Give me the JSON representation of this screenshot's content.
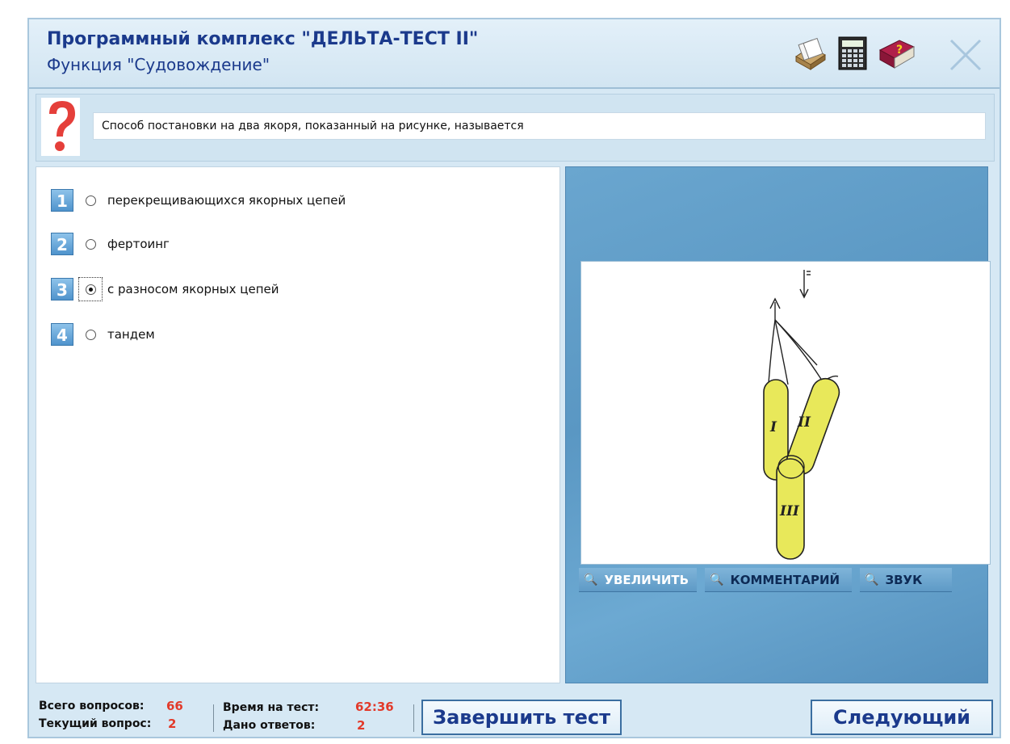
{
  "header": {
    "title": "Программный комплекс \"ДЕЛЬТА-ТЕСТ II\"",
    "subtitle": "Функция \"Судовождение\"",
    "icons": [
      "card-index-icon",
      "calculator-icon",
      "help-book-icon",
      "close-icon"
    ]
  },
  "question": {
    "icon": "question-mark-icon",
    "text": "Способ постановки на два якоря, показанный на рисунке, называется"
  },
  "answers": [
    {
      "num": "1",
      "label": "перекрещивающихся якорных цепей",
      "selected": false
    },
    {
      "num": "2",
      "label": "фертоинг",
      "selected": false
    },
    {
      "num": "3",
      "label": "с разносом якорных цепей",
      "selected": true
    },
    {
      "num": "4",
      "label": "тандем",
      "selected": false
    }
  ],
  "figure": {
    "labels": [
      "I",
      "II",
      "III"
    ],
    "wind_label": "E"
  },
  "image_buttons": {
    "zoom": "УВЕЛИЧИТЬ",
    "comment": "КОММЕНТАРИЙ",
    "sound": "ЗВУК"
  },
  "footer": {
    "total_label": "Всего вопросов:",
    "total_value": "66",
    "current_label": "Текущий вопрос:",
    "current_value": "2",
    "time_label": "Время на тест:",
    "time_value": "62:36",
    "answered_label": "Дано ответов:",
    "answered_value": "2",
    "finish_button": "Завершить тест",
    "next_button": "Следующий"
  },
  "colors": {
    "title": "#1b3a8c",
    "accent_value": "#e23a2a",
    "panel_bg": "#d6e8f4",
    "figure_yellow": "#e8e85a"
  }
}
